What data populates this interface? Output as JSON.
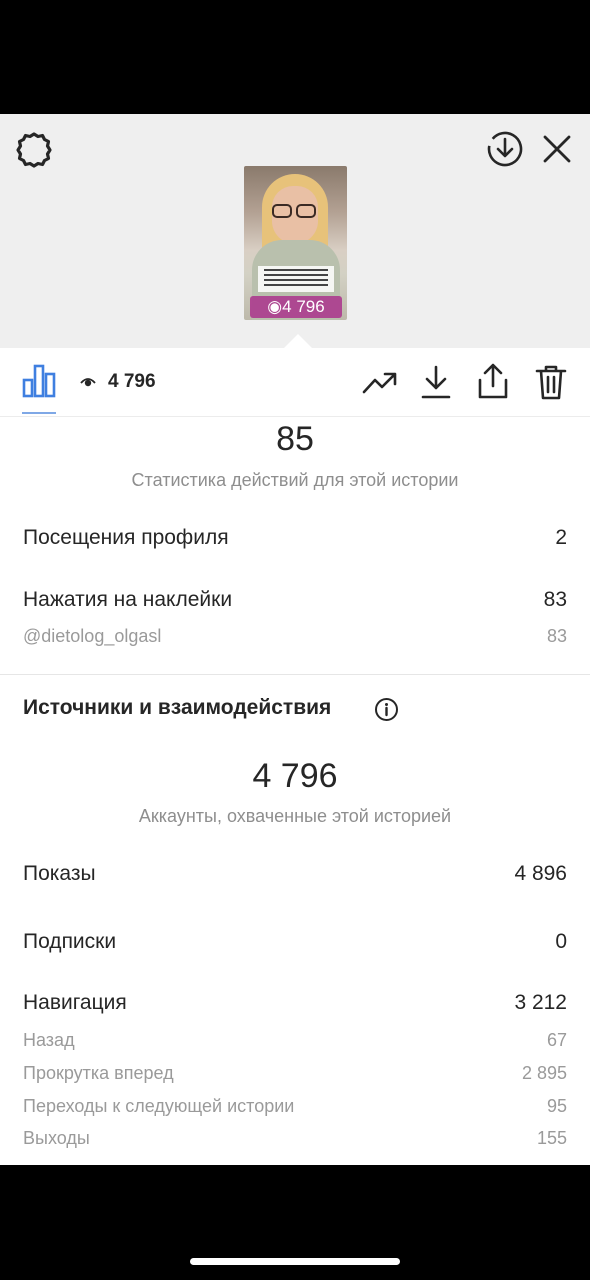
{
  "story_preview": {
    "views_badge": "4 796",
    "caption_lines": 4
  },
  "toolbar": {
    "views": "4 796",
    "icons": [
      "bar-chart-icon",
      "eye-icon",
      "trending-up-icon",
      "download-icon",
      "share-icon",
      "trash-icon"
    ],
    "active_color": "#7fa8e6"
  },
  "actions": {
    "total": "85",
    "caption": "Статистика действий для этой истории",
    "rows": [
      {
        "label": "Посещения профиля",
        "value": "2"
      },
      {
        "label": "Нажатия на наклейки",
        "value": "83"
      }
    ],
    "sticker_sub": {
      "label": "@dietolog_olgasl",
      "value": "83"
    }
  },
  "discovery": {
    "title": "Источники и взаимодействия",
    "reach": "4 796",
    "reach_caption": "Аккаунты, охваченные этой историей",
    "rows": [
      {
        "label": "Показы",
        "value": "4 896"
      },
      {
        "label": "Подписки",
        "value": "0"
      },
      {
        "label": "Навигация",
        "value": "3 212"
      }
    ],
    "navigation_sub": [
      {
        "label": "Назад",
        "value": "67"
      },
      {
        "label": "Прокрутка вперед",
        "value": "2 895"
      },
      {
        "label": "Переходы к следующей истории",
        "value": "95"
      },
      {
        "label": "Выходы",
        "value": "155"
      }
    ]
  }
}
